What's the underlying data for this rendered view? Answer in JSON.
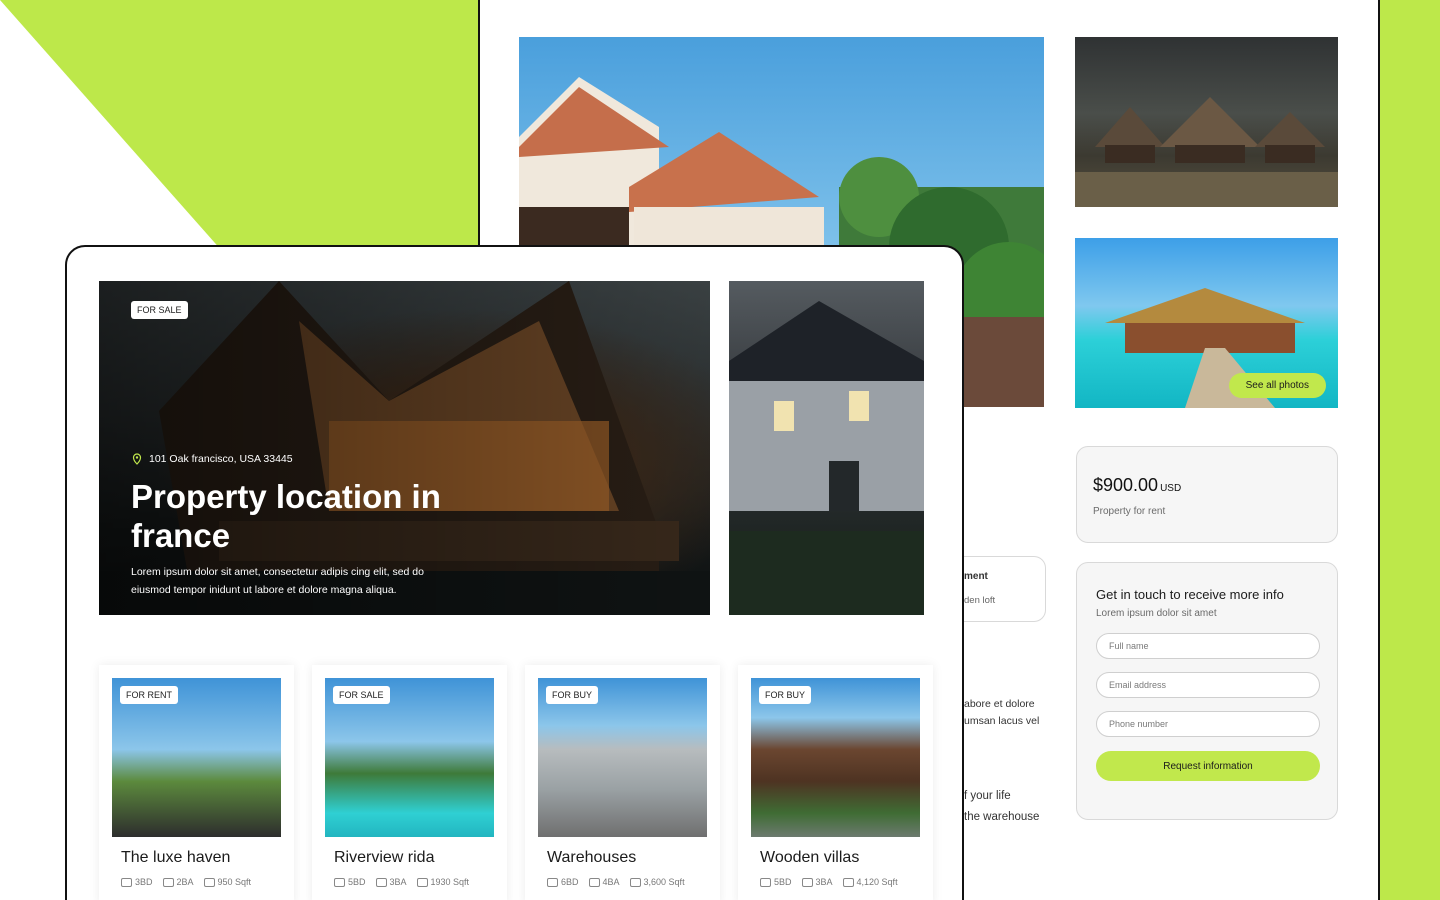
{
  "colors": {
    "accent": "#c1e84c",
    "background_accent": "#bde84a"
  },
  "detail": {
    "see_all": "See all photos",
    "price": "$900.00",
    "currency": "USD",
    "price_sub": "Property for rent",
    "contact": {
      "title": "Get in touch to receive more info",
      "subtitle": "Lorem ipsum dolor sit amet",
      "full_name": "Full name",
      "email": "Email address",
      "phone": "Phone number",
      "button": "Request information"
    },
    "partials": [
      "ment",
      "den loft",
      "abore et dolore",
      "umsan lacus vel",
      "f your life",
      "the warehouse"
    ]
  },
  "hero": {
    "tag": "FOR SALE",
    "address": "101 Oak francisco, USA 33445",
    "title": "Property location in france",
    "description": "Lorem ipsum dolor sit amet, consectetur adipis cing elit, sed do eiusmod tempor inidunt ut labore et dolore magna aliqua."
  },
  "listings": [
    {
      "tag": "FOR RENT",
      "title": "The luxe haven",
      "beds": "3BD",
      "baths": "2BA",
      "area": "950 Sqft"
    },
    {
      "tag": "FOR SALE",
      "title": "Riverview rida",
      "beds": "5BD",
      "baths": "3BA",
      "area": "1930 Sqft"
    },
    {
      "tag": "FOR BUY",
      "title": "Warehouses",
      "beds": "6BD",
      "baths": "4BA",
      "area": "3,600 Sqft"
    },
    {
      "tag": "FOR BUY",
      "title": "Wooden villas",
      "beds": "5BD",
      "baths": "3BA",
      "area": "4,120 Sqft"
    }
  ]
}
